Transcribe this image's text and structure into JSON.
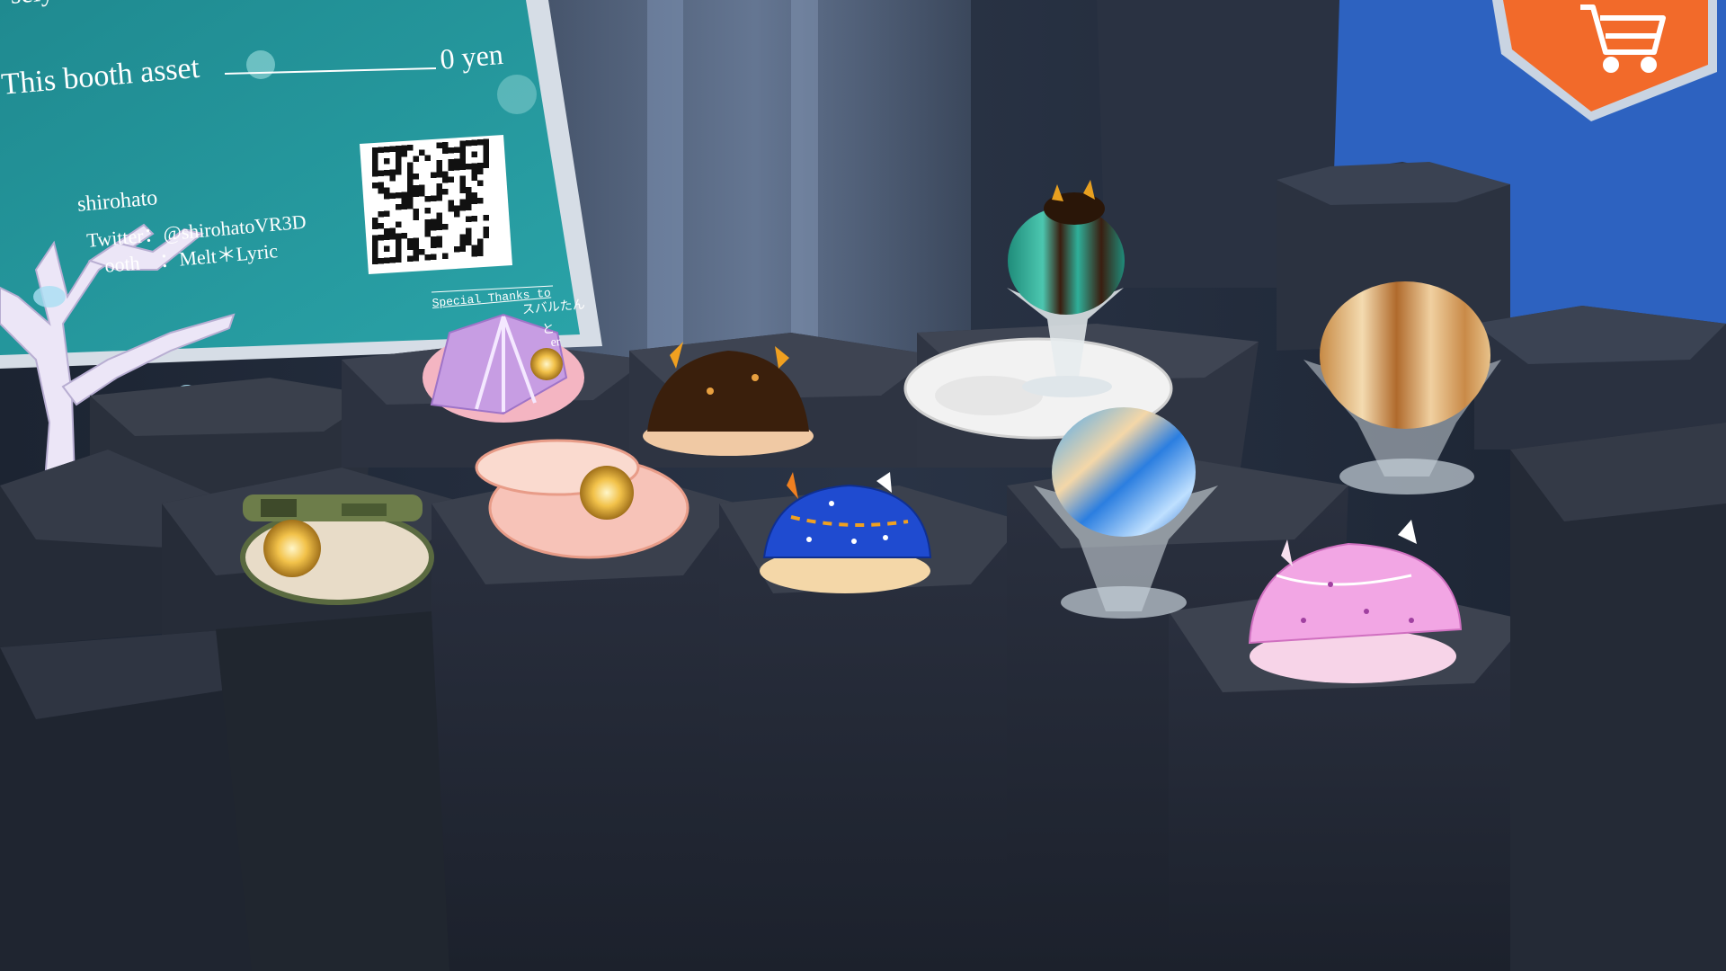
{
  "sign": {
    "header_fragment": "sely use",
    "asset_label": "This booth asset",
    "price": "0 yen",
    "author_name": "shirohato",
    "twitter_line": "Twitter：@shirohatoVR3D",
    "booth_line": "ooth　：Melt＊Lyric",
    "special_thanks": "Special Thanks to",
    "thanks_names": [
      "スバルたん",
      "と",
      "er"
    ]
  },
  "shop": {
    "icon": "shopping-cart-icon",
    "accent": "#f26a2a"
  },
  "display_items": [
    {
      "name": "purple-scallop-shell",
      "color": "#c9a5e0"
    },
    {
      "name": "pink-clam-pearl",
      "color": "#f7c3b8"
    },
    {
      "name": "camo-clam-pearl",
      "color": "#e8dcc8"
    },
    {
      "name": "chocolate-nudibranch",
      "color": "#3a1f0c"
    },
    {
      "name": "blue-nudibranch",
      "color": "#1f4bd0"
    },
    {
      "name": "pink-nudibranch",
      "color": "#f2a6e4"
    },
    {
      "name": "mint-chocolate-dome",
      "color": "#2aa68f"
    },
    {
      "name": "blue-swirl-dome",
      "color": "#3a8ee8"
    },
    {
      "name": "caramel-swirl-dome",
      "color": "#d8a25e"
    },
    {
      "name": "white-plate",
      "color": "#f2f2f2"
    }
  ]
}
